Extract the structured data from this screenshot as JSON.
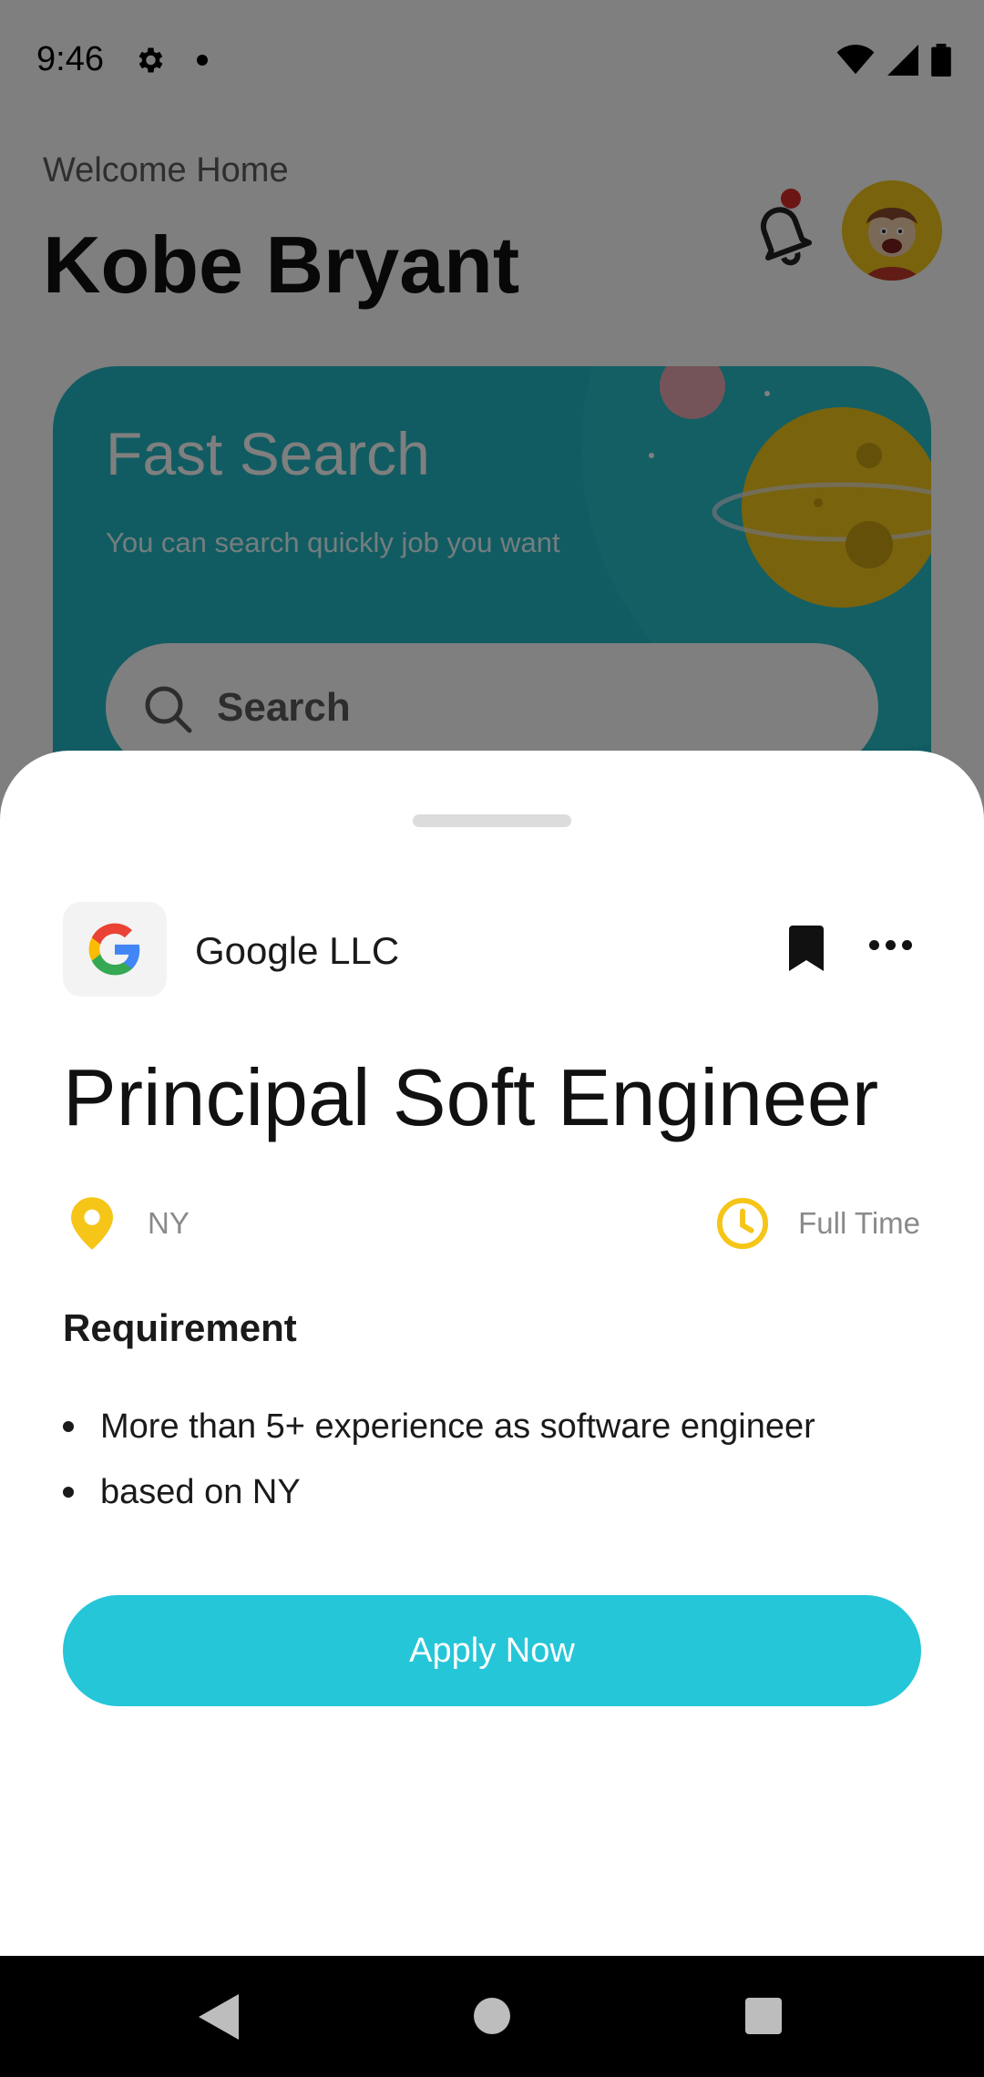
{
  "status_bar": {
    "time": "9:46"
  },
  "home": {
    "welcome": "Welcome Home",
    "user_name": "Kobe Bryant",
    "hero": {
      "title": "Fast Search",
      "subtitle": "You can search quickly job you want",
      "search_placeholder": "Search"
    }
  },
  "job": {
    "company": "Google LLC",
    "title": "Principal Soft Engineer",
    "location": "NY",
    "type": "Full Time",
    "requirement_heading": "Requirement",
    "requirements": [
      "More than 5+ experience as software engineer",
      "based on NY"
    ],
    "apply_label": "Apply Now"
  },
  "colors": {
    "accent": "#25c6d8",
    "icon_yellow": "#f5c518",
    "hero_teal": "#22b9c4"
  }
}
